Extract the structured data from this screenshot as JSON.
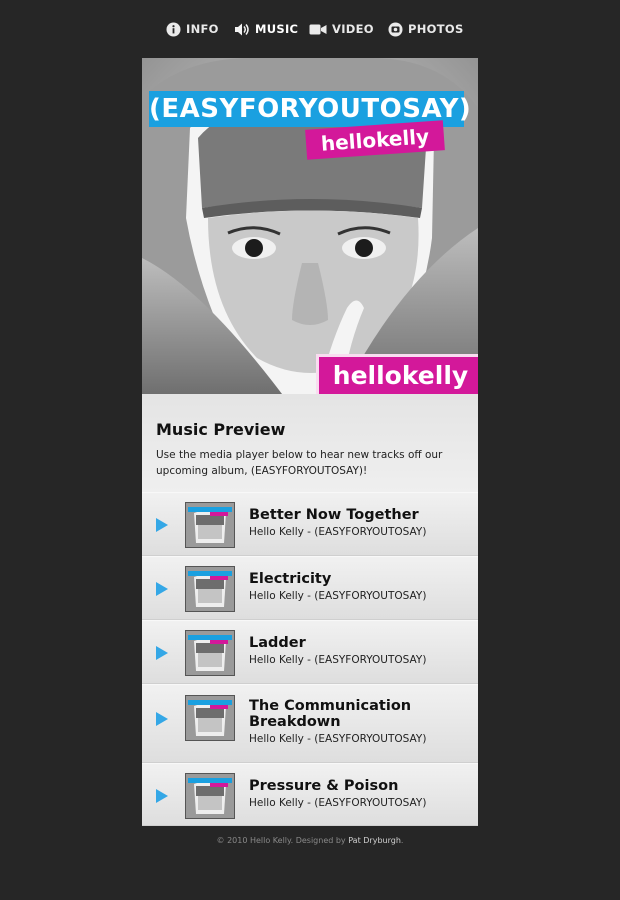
{
  "nav": {
    "items": [
      {
        "label": "INFO",
        "icon": "info-icon"
      },
      {
        "label": "MUSIC",
        "icon": "speaker-icon"
      },
      {
        "label": "VIDEO",
        "icon": "video-camera-icon"
      },
      {
        "label": "PHOTOS",
        "icon": "camera-icon"
      }
    ]
  },
  "hero": {
    "album_title": "(EASYFORYOUTOSAY)",
    "brand_small": "hellokelly",
    "brand_large": "hellokelly"
  },
  "preview": {
    "title": "Music Preview",
    "description": "Use the media player below to hear new tracks off our upcoming album, (EASYFORYOUTOSAY)!"
  },
  "tracks": [
    {
      "title": "Better Now Together",
      "artist": "Hello Kelly - (EASYFORYOUTOSAY)"
    },
    {
      "title": "Electricity",
      "artist": "Hello Kelly - (EASYFORYOUTOSAY)"
    },
    {
      "title": "Ladder",
      "artist": "Hello Kelly - (EASYFORYOUTOSAY)"
    },
    {
      "title": "The Communication Breakdown",
      "artist": "Hello Kelly - (EASYFORYOUTOSAY)"
    },
    {
      "title": "Pressure & Poison",
      "artist": "Hello Kelly - (EASYFORYOUTOSAY)"
    }
  ],
  "footer": {
    "text": "© 2010 Hello Kelly. Designed by",
    "designer": "Pat Dryburgh",
    "end": "."
  },
  "colors": {
    "background": "#262626",
    "accent_blue": "#1aa0e0",
    "accent_pink": "#d3189a",
    "play_blue": "#34a7e6"
  }
}
